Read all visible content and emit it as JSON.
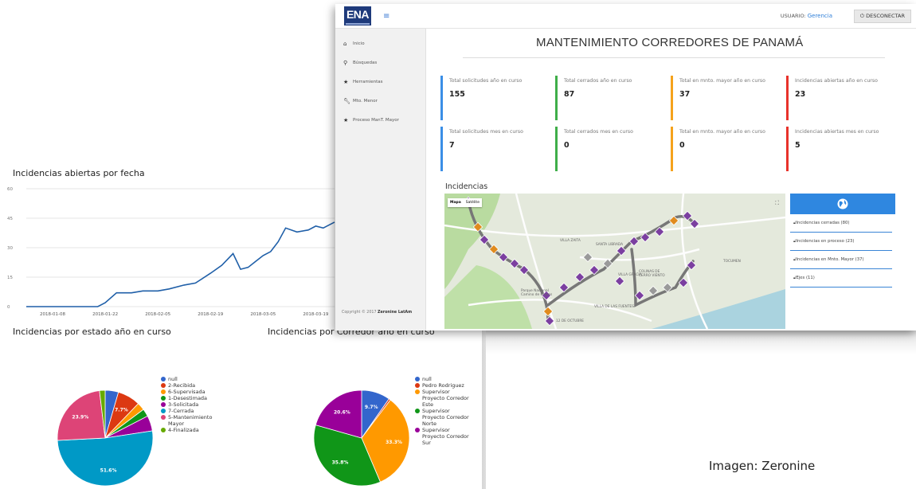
{
  "dashboard": {
    "user_label": "USUARIO:",
    "user_name": "Gerencia",
    "logout_label": "DESCONECTAR",
    "title": "MANTENIMIENTO CORREDORES DE PANAMÁ",
    "logo_text": "ENA",
    "nav": [
      {
        "label": "Inicio",
        "icon": "home-icon"
      },
      {
        "label": "Búsquedas",
        "icon": "search-icon"
      },
      {
        "label": "Herramientas",
        "icon": "star-icon"
      },
      {
        "label": "Mto. Menor",
        "icon": "wrench-icon"
      },
      {
        "label": "Proceso ManT. Mayor",
        "icon": "star-icon"
      }
    ],
    "copyright_prefix": "Copyright © 2017",
    "copyright_company": "Zeronine LatAm",
    "kpis": [
      {
        "label": "Total solicitudes año en curso",
        "value": "155",
        "color": "#3a8ee6"
      },
      {
        "label": "Total cerrados año en curso",
        "value": "87",
        "color": "#3fae49"
      },
      {
        "label": "Total en mnto. mayor año en curso",
        "value": "37",
        "color": "#f5a21c"
      },
      {
        "label": "Incidencias abiertas año en curso",
        "value": "23",
        "color": "#e8322b"
      },
      {
        "label": "Total solicitudes mes en curso",
        "value": "7",
        "color": "#3a8ee6"
      },
      {
        "label": "Total cerrados mes en curso",
        "value": "0",
        "color": "#3fae49"
      },
      {
        "label": "Total en mnto. mayor año en curso",
        "value": "0",
        "color": "#f5a21c"
      },
      {
        "label": "Incidencias abiertas mes en curso",
        "value": "5",
        "color": "#e8322b"
      }
    ],
    "map": {
      "section_title": "Incidencias",
      "tab_map": "Mapa",
      "tab_satellite": "Satélite",
      "labels": [
        "VILLA ZAITA",
        "SANTA LIBRADA",
        "VILLA GRACIA",
        "COLINAS DE CERRO VIENTO",
        "TOCUMEN",
        "Parque Nacional Camino de Cruces",
        "12 DE OCTUBRE",
        "VILLA DE LAS FUENTES"
      ]
    },
    "map_legend": [
      "Incidencias cerradas (80)",
      "Incidencias en proceso (23)",
      "Incidencias en Mnto. Mayor (37)",
      "Ejes (11)"
    ]
  },
  "line_chart_title": "Incidencias abiertas por fecha",
  "pie1_title": "Incidencias por estado año en curso",
  "pie2_title": "Incidencias por Corredor año en curso",
  "credit": "Imagen: Zeronine",
  "chart_data": [
    {
      "type": "line",
      "title": "Incidencias abiertas por fecha",
      "x_ticks": [
        "2018-01-08",
        "2018-01-22",
        "2018-02-05",
        "2018-02-19",
        "2018-03-05",
        "2018-03-19"
      ],
      "y_ticks": [
        0,
        15,
        30,
        45,
        60
      ],
      "ylim": [
        0,
        60
      ],
      "series": [
        {
          "color": "#1f5fa8",
          "x": [
            "2018-01-01",
            "2018-01-08",
            "2018-01-15",
            "2018-01-20",
            "2018-01-22",
            "2018-01-25",
            "2018-01-29",
            "2018-02-01",
            "2018-02-05",
            "2018-02-08",
            "2018-02-12",
            "2018-02-15",
            "2018-02-19",
            "2018-02-22",
            "2018-02-25",
            "2018-02-27",
            "2018-03-01",
            "2018-03-03",
            "2018-03-05",
            "2018-03-07",
            "2018-03-09",
            "2018-03-11",
            "2018-03-14",
            "2018-03-17",
            "2018-03-19",
            "2018-03-21",
            "2018-03-24"
          ],
          "y": [
            0,
            0,
            0,
            0,
            2,
            7,
            7,
            8,
            8,
            9,
            11,
            12,
            17,
            21,
            27,
            19,
            20,
            23,
            26,
            28,
            33,
            40,
            38,
            39,
            41,
            40,
            43
          ]
        }
      ]
    },
    {
      "type": "pie",
      "title": "Incidencias por estado año en curso",
      "labels": [
        "null",
        "2-Recibida",
        "6-Supervisada",
        "1-Desestimada",
        "3-Solicitada",
        "7-Cerrada",
        "5-Mantenimiento Mayor",
        "4-Finalizada"
      ],
      "values": [
        4.5,
        7.7,
        2.6,
        2.6,
        5.2,
        51.6,
        23.9,
        1.9
      ],
      "data_labels": [
        "",
        "7.7%",
        "",
        "",
        "",
        "51.6%",
        "23.9%",
        ""
      ],
      "colors": [
        "#3366cc",
        "#dc3912",
        "#ff9900",
        "#109618",
        "#990099",
        "#0099c6",
        "#dd4477",
        "#66aa00"
      ]
    },
    {
      "type": "pie",
      "title": "Incidencias por Corredor año en curso",
      "labels": [
        "null",
        "Pedro Rodriguez",
        "Supervisor Proyecto Corredor Este",
        "Supervisor Proyecto Corredor Norte",
        "Supervisor Proyecto Corredor Sur"
      ],
      "values": [
        9.7,
        0.6,
        33.3,
        35.8,
        20.6
      ],
      "data_labels": [
        "9.7%",
        "",
        "33.3%",
        "35.8%",
        "20.6%"
      ],
      "colors": [
        "#3366cc",
        "#dc3912",
        "#ff9900",
        "#109618",
        "#990099"
      ]
    }
  ]
}
